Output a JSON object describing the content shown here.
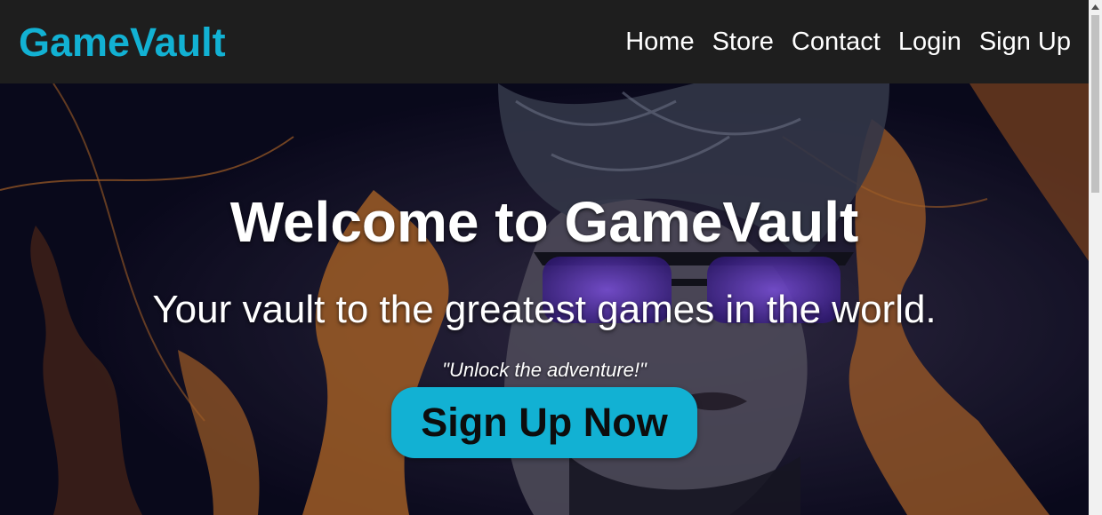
{
  "navbar": {
    "brand": "GameVault",
    "links": [
      {
        "label": "Home"
      },
      {
        "label": "Store"
      },
      {
        "label": "Contact"
      },
      {
        "label": "Login"
      },
      {
        "label": "Sign Up"
      }
    ]
  },
  "hero": {
    "title": "Welcome to GameVault",
    "subtitle": "Your vault to the greatest games in the world.",
    "tagline": "\"Unlock the adventure!\"",
    "cta_label": "Sign Up Now",
    "background_image": "stylized-woman-with-purple-sunglasses-paint-splashes-icon"
  },
  "colors": {
    "navbar_bg": "#1e1e1e",
    "brand": "#12b1d3",
    "cta_bg": "#12b1d3",
    "cta_text": "#0d0d0d",
    "hero_text": "#ffffff"
  }
}
